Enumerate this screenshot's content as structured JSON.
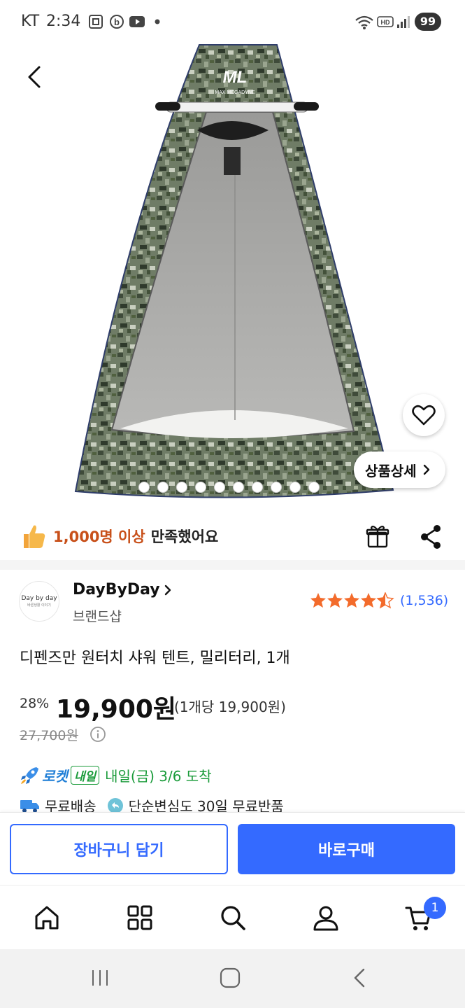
{
  "status_bar": {
    "carrier": "KT",
    "time": "2:34",
    "battery": "99"
  },
  "product_image": {
    "brand_text": "MAX MEGADYNE",
    "slide_count": 10,
    "active_slide": 0
  },
  "detail_button": {
    "label": "상품상세"
  },
  "satisfaction": {
    "highlight": "1,000명 이상",
    "rest": "만족했어요"
  },
  "brand": {
    "logo_line1": "Day by day",
    "logo_line2": "바른생활 이야기",
    "name": "DayByDay",
    "sub": "브랜드샵"
  },
  "rating": {
    "stars": 4.5,
    "count": "(1,536)"
  },
  "product": {
    "title": "디펜즈만 원터치 샤워 텐트, 밀리터리, 1개",
    "discount": "28%",
    "price": "19,900원",
    "unit_price": "(1개당 19,900원)",
    "original_price": "27,700원"
  },
  "delivery": {
    "rocket_label": "로켓",
    "tomorrow_badge": "내일",
    "arrival": "내일(금) 3/6 도착",
    "free_shipping": "무료배송",
    "return_policy": "단순변심도 30일 무료반품"
  },
  "actions": {
    "cart_label": "장바구니 담기",
    "buy_label": "바로구매"
  },
  "bottom_nav": {
    "items": [
      "home-icon",
      "category-icon",
      "search-icon",
      "my-page-icon",
      "cart-icon"
    ],
    "cart_badge": "1"
  },
  "colors": {
    "accent": "#346aff",
    "highlight": "#c8501a",
    "rocket_blue": "#1f7ed6",
    "tomorrow_green": "#1a9b3a",
    "star": "#f36b2b"
  }
}
